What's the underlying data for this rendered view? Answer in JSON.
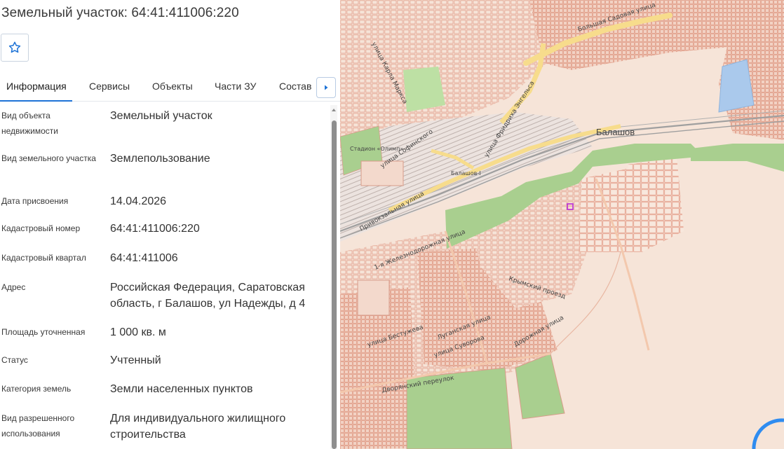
{
  "title": "Земельный участок: 64:41:411006:220",
  "favorite": {
    "icon": "star-icon"
  },
  "tabs": [
    {
      "label": "Информация",
      "active": true
    },
    {
      "label": "Сервисы"
    },
    {
      "label": "Объекты"
    },
    {
      "label": "Части ЗУ"
    },
    {
      "label": "Состав"
    }
  ],
  "tab_scroll_icon": "chevron-right-icon",
  "fields": [
    {
      "label": "Вид объекта недвижимости",
      "value": "Земельный участок"
    },
    {
      "label": "Вид земельного участка",
      "value": "Землепользование"
    },
    {
      "label": "Дата присвоения",
      "value": "14.04.2026"
    },
    {
      "label": "Кадастровый номер",
      "value": "64:41:411006:220"
    },
    {
      "label": "Кадастровый квартал",
      "value": "64:41:411006"
    },
    {
      "label": "Адрес",
      "value": "Российская Федерация, Саратовская область, г Балашов, ул Надежды, д 4"
    },
    {
      "label": "Площадь уточненная",
      "value": "1 000 кв. м"
    },
    {
      "label": "Статус",
      "value": "Учтенный"
    },
    {
      "label": "Категория земель",
      "value": "Земли населенных пунктов"
    },
    {
      "label": "Вид разрешенного использования",
      "value": "Для индивидуального жилищного строительства"
    }
  ],
  "map": {
    "city_label": "Балашов",
    "station_label": "Балашов-I",
    "stadium_label": "Стадион «Олимп»",
    "streets": [
      "улица Карла Маркса",
      "Большая Садовая улица",
      "улица Фридриха Энгельса",
      "Привокзальная улица",
      "улица Софинского",
      "1-я Железнодорожная улица",
      "Крымский проезд",
      "Дорожная улица",
      "Дворянский переулок",
      "улица Бестужева",
      "Луганская улица",
      "улица Суворова"
    ],
    "colors": {
      "background": "#f6e4d8",
      "blocks": "#e8a48e",
      "green": "#a9cf8f",
      "water": "#aac9ec",
      "roads_major": "#f7dc8c",
      "selected_parcel": "#b92ed8"
    }
  }
}
